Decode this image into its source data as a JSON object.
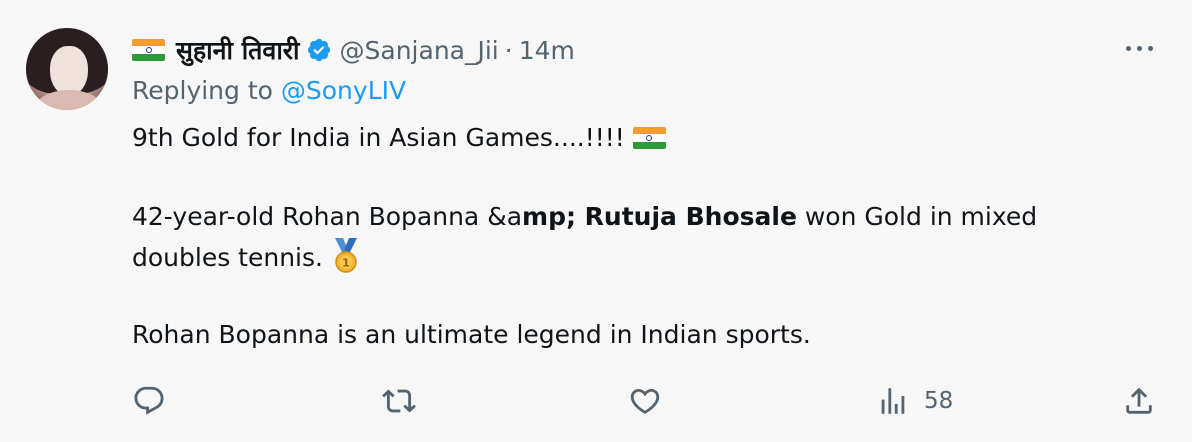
{
  "tweet": {
    "display_name": "सुहानी तिवारी",
    "handle": "@Sanjana_Jii",
    "separator": "·",
    "time": "14m",
    "replying_prefix": "Replying to ",
    "replying_to": "@SonyLIV",
    "line1": "9th Gold for India in Asian Games....!!!!",
    "line2_normal": "42-year-old Rohan Bopanna &a",
    "line2_bold": "mp; Rutuja Bhosale",
    "line2_end": " won Gold in mixed",
    "line3": "doubles tennis.",
    "line4": "Rohan Bopanna is an ultimate legend in Indian sports.",
    "icons": {
      "flag": "india-flag-emoji",
      "verified": "verified-badge-icon",
      "medal": "gold-medal-emoji",
      "more": "more-options-icon",
      "reply": "reply-icon",
      "retweet": "retweet-icon",
      "like": "like-icon",
      "views": "views-icon",
      "share": "share-icon"
    },
    "actions": {
      "views_count": "58"
    },
    "colors": {
      "link": "#1d9bf0",
      "secondary_text": "#536471",
      "verified": "#1d9bf0",
      "background": "#f7f7f7"
    }
  }
}
